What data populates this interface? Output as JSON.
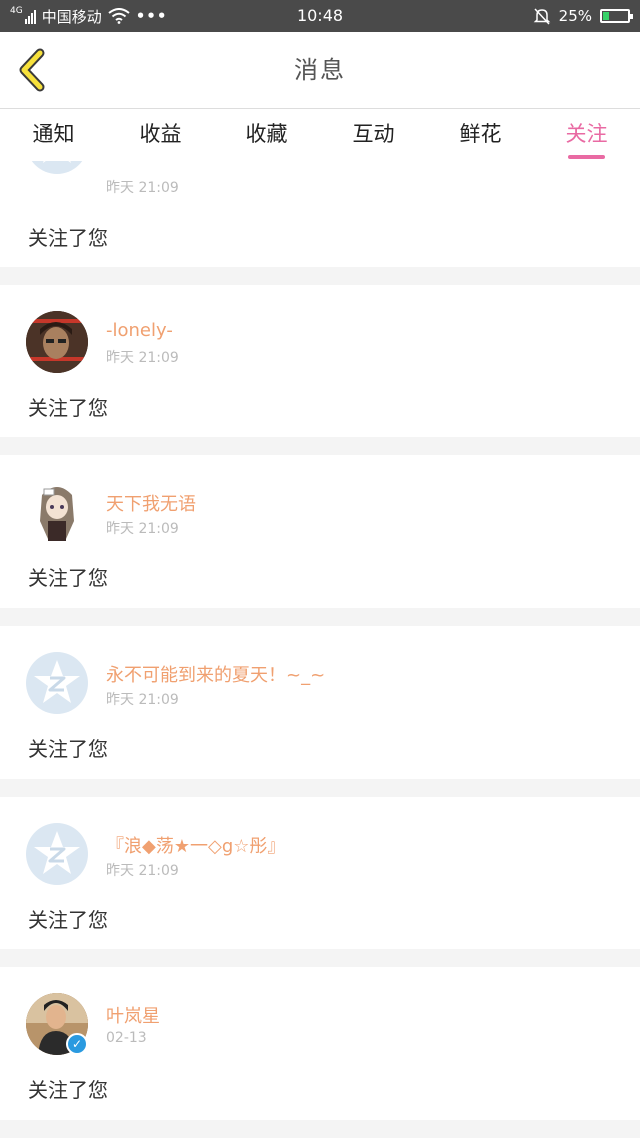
{
  "status_bar": {
    "network": "4G",
    "carrier": "中国移动",
    "time": "10:48",
    "battery": "25%",
    "battery_level": 0.25,
    "icons": [
      "signal-icon",
      "wifi-icon",
      "more-dots-icon",
      "mute-bell-icon",
      "battery-icon"
    ]
  },
  "header": {
    "title": "消息",
    "back_icon": "chevron-left-icon"
  },
  "tabs": [
    {
      "label": "通知",
      "active": false
    },
    {
      "label": "收益",
      "active": false
    },
    {
      "label": "收藏",
      "active": false
    },
    {
      "label": "互动",
      "active": false
    },
    {
      "label": "鲜花",
      "active": false
    },
    {
      "label": "关注",
      "active": true
    }
  ],
  "feed": [
    {
      "name": "",
      "time": "昨天 21:09",
      "message": "关注了您",
      "avatar": "default-z-avatar"
    },
    {
      "name": "-lonely-",
      "time": "昨天 21:09",
      "message": "关注了您",
      "avatar": "photo-avatar"
    },
    {
      "name": "天下我无语",
      "time": "昨天 21:09",
      "message": "关注了您",
      "avatar": "anime-avatar"
    },
    {
      "name": "永不可能到来的夏天！~_~",
      "time": "昨天 21:09",
      "message": "关注了您",
      "avatar": "default-z-avatar"
    },
    {
      "name": "『浪◆荡★一◇g☆彤』",
      "time": "昨天 21:09",
      "message": "关注了您",
      "avatar": "default-z-avatar"
    },
    {
      "name": "叶岚星",
      "time": "02-13",
      "message": "关注了您",
      "avatar": "photo-avatar",
      "verified": true
    }
  ],
  "colors": {
    "accent": "#e96aa3",
    "name": "#f0a070",
    "status_bar": "#4a4a4a",
    "battery": "#38d26a"
  }
}
